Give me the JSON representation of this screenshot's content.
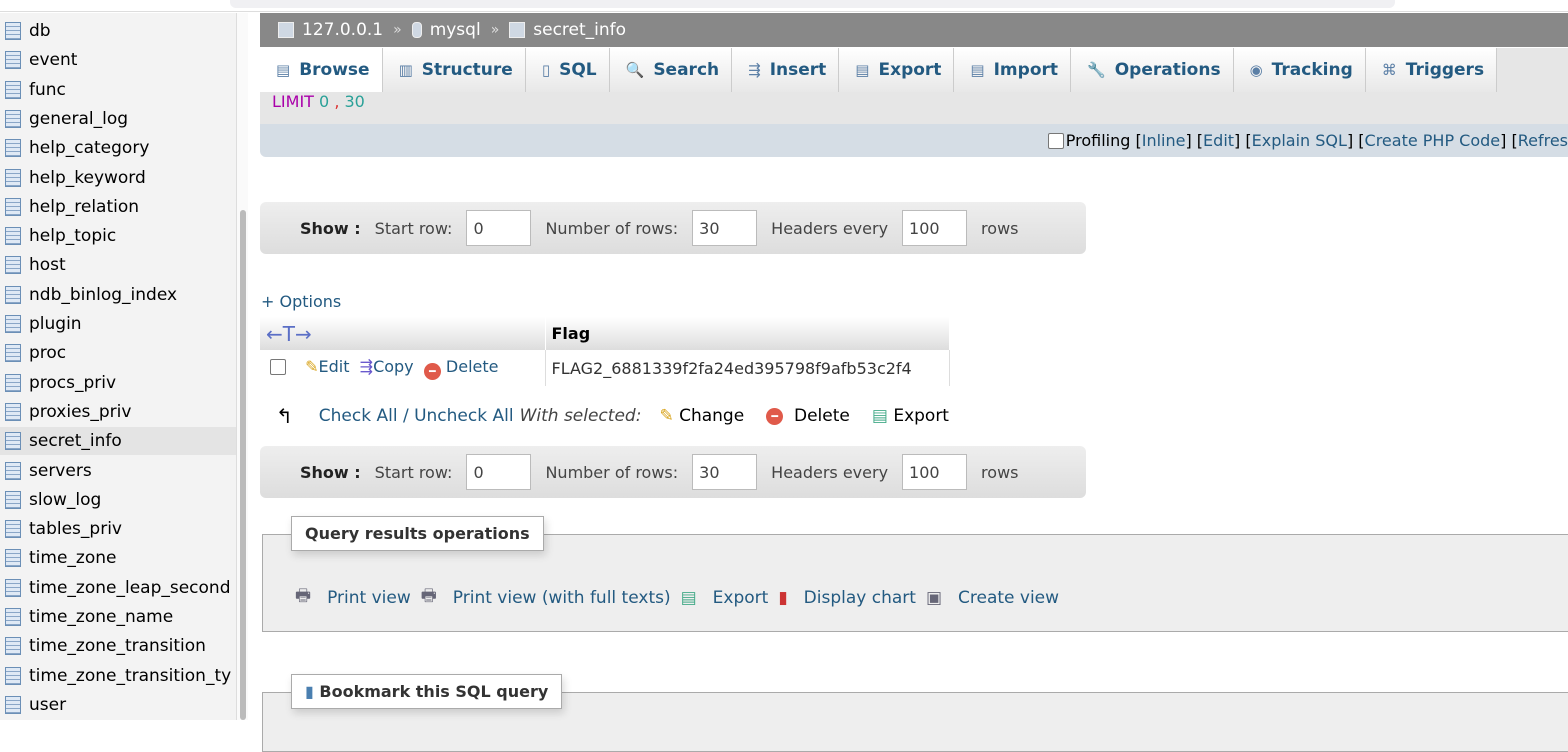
{
  "sidebar": {
    "items": [
      {
        "label": "db"
      },
      {
        "label": "event"
      },
      {
        "label": "func"
      },
      {
        "label": "general_log"
      },
      {
        "label": "help_category"
      },
      {
        "label": "help_keyword"
      },
      {
        "label": "help_relation"
      },
      {
        "label": "help_topic"
      },
      {
        "label": "host"
      },
      {
        "label": "ndb_binlog_index"
      },
      {
        "label": "plugin"
      },
      {
        "label": "proc"
      },
      {
        "label": "procs_priv"
      },
      {
        "label": "proxies_priv"
      },
      {
        "label": "secret_info",
        "selected": true
      },
      {
        "label": "servers"
      },
      {
        "label": "slow_log"
      },
      {
        "label": "tables_priv"
      },
      {
        "label": "time_zone"
      },
      {
        "label": "time_zone_leap_second"
      },
      {
        "label": "time_zone_name"
      },
      {
        "label": "time_zone_transition"
      },
      {
        "label": "time_zone_transition_ty"
      },
      {
        "label": "user"
      }
    ]
  },
  "breadcrumb": {
    "server": "127.0.0.1",
    "database": "mysql",
    "table": "secret_info",
    "separator": "»"
  },
  "tabs": [
    {
      "label": "Browse",
      "icon": "browse-icon",
      "active": true
    },
    {
      "label": "Structure",
      "icon": "structure-icon"
    },
    {
      "label": "SQL",
      "icon": "sql-icon"
    },
    {
      "label": "Search",
      "icon": "search-icon"
    },
    {
      "label": "Insert",
      "icon": "insert-icon"
    },
    {
      "label": "Export",
      "icon": "export-icon"
    },
    {
      "label": "Import",
      "icon": "import-icon"
    },
    {
      "label": "Operations",
      "icon": "wrench-icon"
    },
    {
      "label": "Tracking",
      "icon": "eye-icon"
    },
    {
      "label": "Triggers",
      "icon": "triggers-icon"
    }
  ],
  "sql": {
    "keyword": "LIMIT",
    "offset": "0",
    "sep": ",",
    "count": "30"
  },
  "profiling": {
    "label": "Profiling",
    "inline": "Inline",
    "edit": "Edit",
    "explain": "Explain SQL",
    "php": "Create PHP Code",
    "refresh": "Refres"
  },
  "showbar": {
    "show": "Show :",
    "start_label": "Start row:",
    "start": "0",
    "rows_label": "Number of rows:",
    "rows": "30",
    "headers_label": "Headers every",
    "headers": "100",
    "rows_suffix": "rows"
  },
  "options_label": "+ Options",
  "table": {
    "arrows": "←T→",
    "columns": [
      "Flag"
    ],
    "rows": [
      {
        "edit": "Edit",
        "copy": "Copy",
        "delete": "Delete",
        "values": [
          "FLAG2_6881339f2fa24ed395798f9afb53c2f4"
        ]
      }
    ]
  },
  "checkrow": {
    "check_all": "Check All",
    "slash": "/",
    "uncheck_all": "Uncheck All",
    "with_selected": "With selected:",
    "change": "Change",
    "delete": "Delete",
    "export": "Export"
  },
  "qro": {
    "title": "Query results operations",
    "links": [
      "Print view",
      "Print view (with full texts)",
      "Export",
      "Display chart",
      "Create view"
    ]
  },
  "bookmark": {
    "title": "Bookmark this SQL query"
  }
}
